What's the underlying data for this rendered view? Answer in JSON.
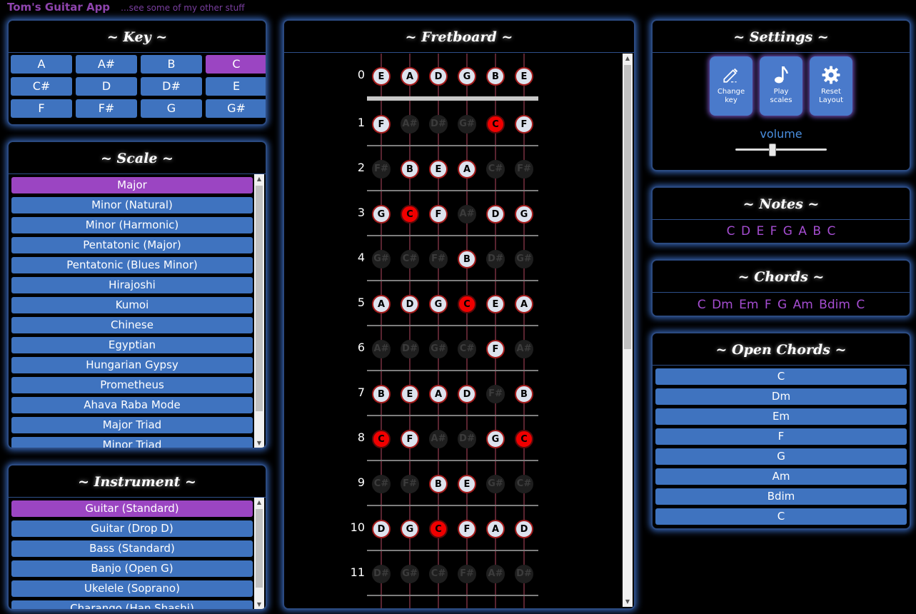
{
  "header": {
    "title": "Tom's Guitar App",
    "link": "...see some of my other stuff"
  },
  "key": {
    "title": "~ Key ~",
    "keys": [
      "A",
      "A#",
      "B",
      "C",
      "C#",
      "D",
      "D#",
      "E",
      "F",
      "F#",
      "G",
      "G#"
    ],
    "selected": "C"
  },
  "scale": {
    "title": "~ Scale ~",
    "items": [
      "Major",
      "Minor (Natural)",
      "Minor (Harmonic)",
      "Pentatonic (Major)",
      "Pentatonic (Blues Minor)",
      "Hirajoshi",
      "Kumoi",
      "Chinese",
      "Egyptian",
      "Hungarian Gypsy",
      "Prometheus",
      "Ahava Raba Mode",
      "Major Triad",
      "Minor Triad"
    ],
    "selected": "Major"
  },
  "instrument": {
    "title": "~ Instrument ~",
    "items": [
      "Guitar (Standard)",
      "Guitar (Drop D)",
      "Bass (Standard)",
      "Banjo (Open G)",
      "Ukelele (Soprano)",
      "Charango (Han Shashi)"
    ],
    "selected": "Guitar (Standard)"
  },
  "fretboard": {
    "title": "~ Fretboard ~",
    "frets": [
      {
        "num": "0",
        "notes": [
          {
            "n": "E",
            "s": "in"
          },
          {
            "n": "A",
            "s": "in"
          },
          {
            "n": "D",
            "s": "in"
          },
          {
            "n": "G",
            "s": "in"
          },
          {
            "n": "B",
            "s": "in"
          },
          {
            "n": "E",
            "s": "in"
          }
        ]
      },
      {
        "num": "1",
        "notes": [
          {
            "n": "F",
            "s": "in"
          },
          {
            "n": "A#",
            "s": "out"
          },
          {
            "n": "D#",
            "s": "out"
          },
          {
            "n": "G#",
            "s": "out"
          },
          {
            "n": "C",
            "s": "root"
          },
          {
            "n": "F",
            "s": "in"
          }
        ]
      },
      {
        "num": "2",
        "notes": [
          {
            "n": "F#",
            "s": "out"
          },
          {
            "n": "B",
            "s": "in"
          },
          {
            "n": "E",
            "s": "in"
          },
          {
            "n": "A",
            "s": "in"
          },
          {
            "n": "C#",
            "s": "out"
          },
          {
            "n": "F#",
            "s": "out"
          }
        ]
      },
      {
        "num": "3",
        "notes": [
          {
            "n": "G",
            "s": "in"
          },
          {
            "n": "C",
            "s": "root"
          },
          {
            "n": "F",
            "s": "in"
          },
          {
            "n": "A#",
            "s": "out"
          },
          {
            "n": "D",
            "s": "in"
          },
          {
            "n": "G",
            "s": "in"
          }
        ]
      },
      {
        "num": "4",
        "notes": [
          {
            "n": "G#",
            "s": "out"
          },
          {
            "n": "C#",
            "s": "out"
          },
          {
            "n": "F#",
            "s": "out"
          },
          {
            "n": "B",
            "s": "in"
          },
          {
            "n": "D#",
            "s": "out"
          },
          {
            "n": "G#",
            "s": "out"
          }
        ]
      },
      {
        "num": "5",
        "notes": [
          {
            "n": "A",
            "s": "in"
          },
          {
            "n": "D",
            "s": "in"
          },
          {
            "n": "G",
            "s": "in"
          },
          {
            "n": "C",
            "s": "root"
          },
          {
            "n": "E",
            "s": "in"
          },
          {
            "n": "A",
            "s": "in"
          }
        ]
      },
      {
        "num": "6",
        "notes": [
          {
            "n": "A#",
            "s": "out"
          },
          {
            "n": "D#",
            "s": "out"
          },
          {
            "n": "G#",
            "s": "out"
          },
          {
            "n": "C#",
            "s": "out"
          },
          {
            "n": "F",
            "s": "in"
          },
          {
            "n": "A#",
            "s": "out"
          }
        ]
      },
      {
        "num": "7",
        "notes": [
          {
            "n": "B",
            "s": "in"
          },
          {
            "n": "E",
            "s": "in"
          },
          {
            "n": "A",
            "s": "in"
          },
          {
            "n": "D",
            "s": "in"
          },
          {
            "n": "F#",
            "s": "out"
          },
          {
            "n": "B",
            "s": "in"
          }
        ]
      },
      {
        "num": "8",
        "notes": [
          {
            "n": "C",
            "s": "root"
          },
          {
            "n": "F",
            "s": "in"
          },
          {
            "n": "A#",
            "s": "out"
          },
          {
            "n": "D#",
            "s": "out"
          },
          {
            "n": "G",
            "s": "in"
          },
          {
            "n": "C",
            "s": "root"
          }
        ]
      },
      {
        "num": "9",
        "notes": [
          {
            "n": "C#",
            "s": "out"
          },
          {
            "n": "F#",
            "s": "out"
          },
          {
            "n": "B",
            "s": "in"
          },
          {
            "n": "E",
            "s": "in"
          },
          {
            "n": "G#",
            "s": "out"
          },
          {
            "n": "C#",
            "s": "out"
          }
        ]
      },
      {
        "num": "10",
        "notes": [
          {
            "n": "D",
            "s": "in"
          },
          {
            "n": "G",
            "s": "in"
          },
          {
            "n": "C",
            "s": "root"
          },
          {
            "n": "F",
            "s": "in"
          },
          {
            "n": "A",
            "s": "in"
          },
          {
            "n": "D",
            "s": "in"
          }
        ]
      },
      {
        "num": "11",
        "notes": [
          {
            "n": "D#",
            "s": "out"
          },
          {
            "n": "G#",
            "s": "out"
          },
          {
            "n": "C#",
            "s": "out"
          },
          {
            "n": "F#",
            "s": "out"
          },
          {
            "n": "A#",
            "s": "out"
          },
          {
            "n": "D#",
            "s": "out"
          }
        ]
      }
    ]
  },
  "settings": {
    "title": "~ Settings ~",
    "buttons": [
      {
        "line1": "Change",
        "line2": "key",
        "icon": "pencil-icon"
      },
      {
        "line1": "Play",
        "line2": "scales",
        "icon": "music-note-icon"
      },
      {
        "line1": "Reset",
        "line2": "Layout",
        "icon": "gear-icon"
      }
    ],
    "volume_label": "volume",
    "volume_level": 0.4
  },
  "notes": {
    "title": "~ Notes ~",
    "text": "C D E F G A B C"
  },
  "chords": {
    "title": "~ Chords ~",
    "text": "C Dm Em F G Am Bdim C"
  },
  "open_chords": {
    "title": "~ Open Chords ~",
    "items": [
      "C",
      "Dm",
      "Em",
      "F",
      "G",
      "Am",
      "Bdim",
      "C"
    ]
  },
  "colors": {
    "accent": "#9b45c2",
    "button": "#3f73bf",
    "root": "#f00000",
    "glow": "#4682eb"
  }
}
